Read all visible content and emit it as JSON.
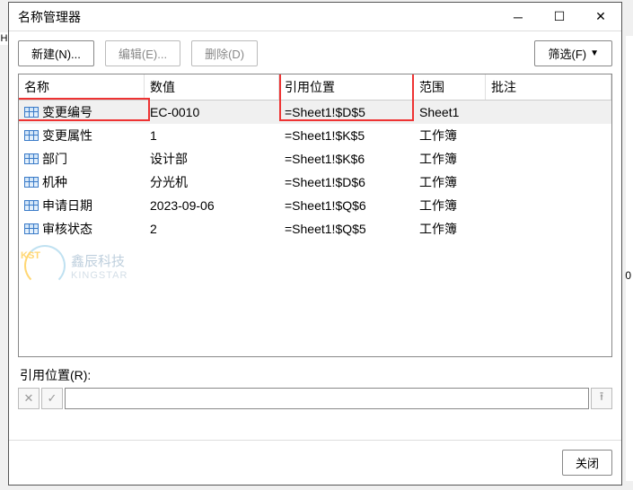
{
  "title": "名称管理器",
  "toolbar": {
    "new": "新建(N)...",
    "edit": "编辑(E)...",
    "delete": "删除(D)",
    "filter": "筛选(F)"
  },
  "columns": {
    "name": "名称",
    "value": "数值",
    "ref": "引用位置",
    "scope": "范围",
    "comment": "批注"
  },
  "rows": [
    {
      "name": "变更编号",
      "value": "EC-0010",
      "ref": "=Sheet1!$D$5",
      "scope": "Sheet1",
      "comment": ""
    },
    {
      "name": "变更属性",
      "value": "1",
      "ref": "=Sheet1!$K$5",
      "scope": "工作簿",
      "comment": ""
    },
    {
      "name": "部门",
      "value": "设计部",
      "ref": "=Sheet1!$K$6",
      "scope": "工作簿",
      "comment": ""
    },
    {
      "name": "机种",
      "value": "分光机",
      "ref": "=Sheet1!$D$6",
      "scope": "工作簿",
      "comment": ""
    },
    {
      "name": "申请日期",
      "value": "2023-09-06",
      "ref": "=Sheet1!$Q$6",
      "scope": "工作簿",
      "comment": ""
    },
    {
      "name": "审核状态",
      "value": "2",
      "ref": "=Sheet1!$Q$5",
      "scope": "工作簿",
      "comment": ""
    }
  ],
  "ref_label": "引用位置(R):",
  "ref_value": "",
  "close": "关闭",
  "watermark": {
    "brand": "鑫辰科技",
    "sub": "KINGSTAR",
    "ks": "KST"
  },
  "bgH": "H",
  "bg0": "0"
}
